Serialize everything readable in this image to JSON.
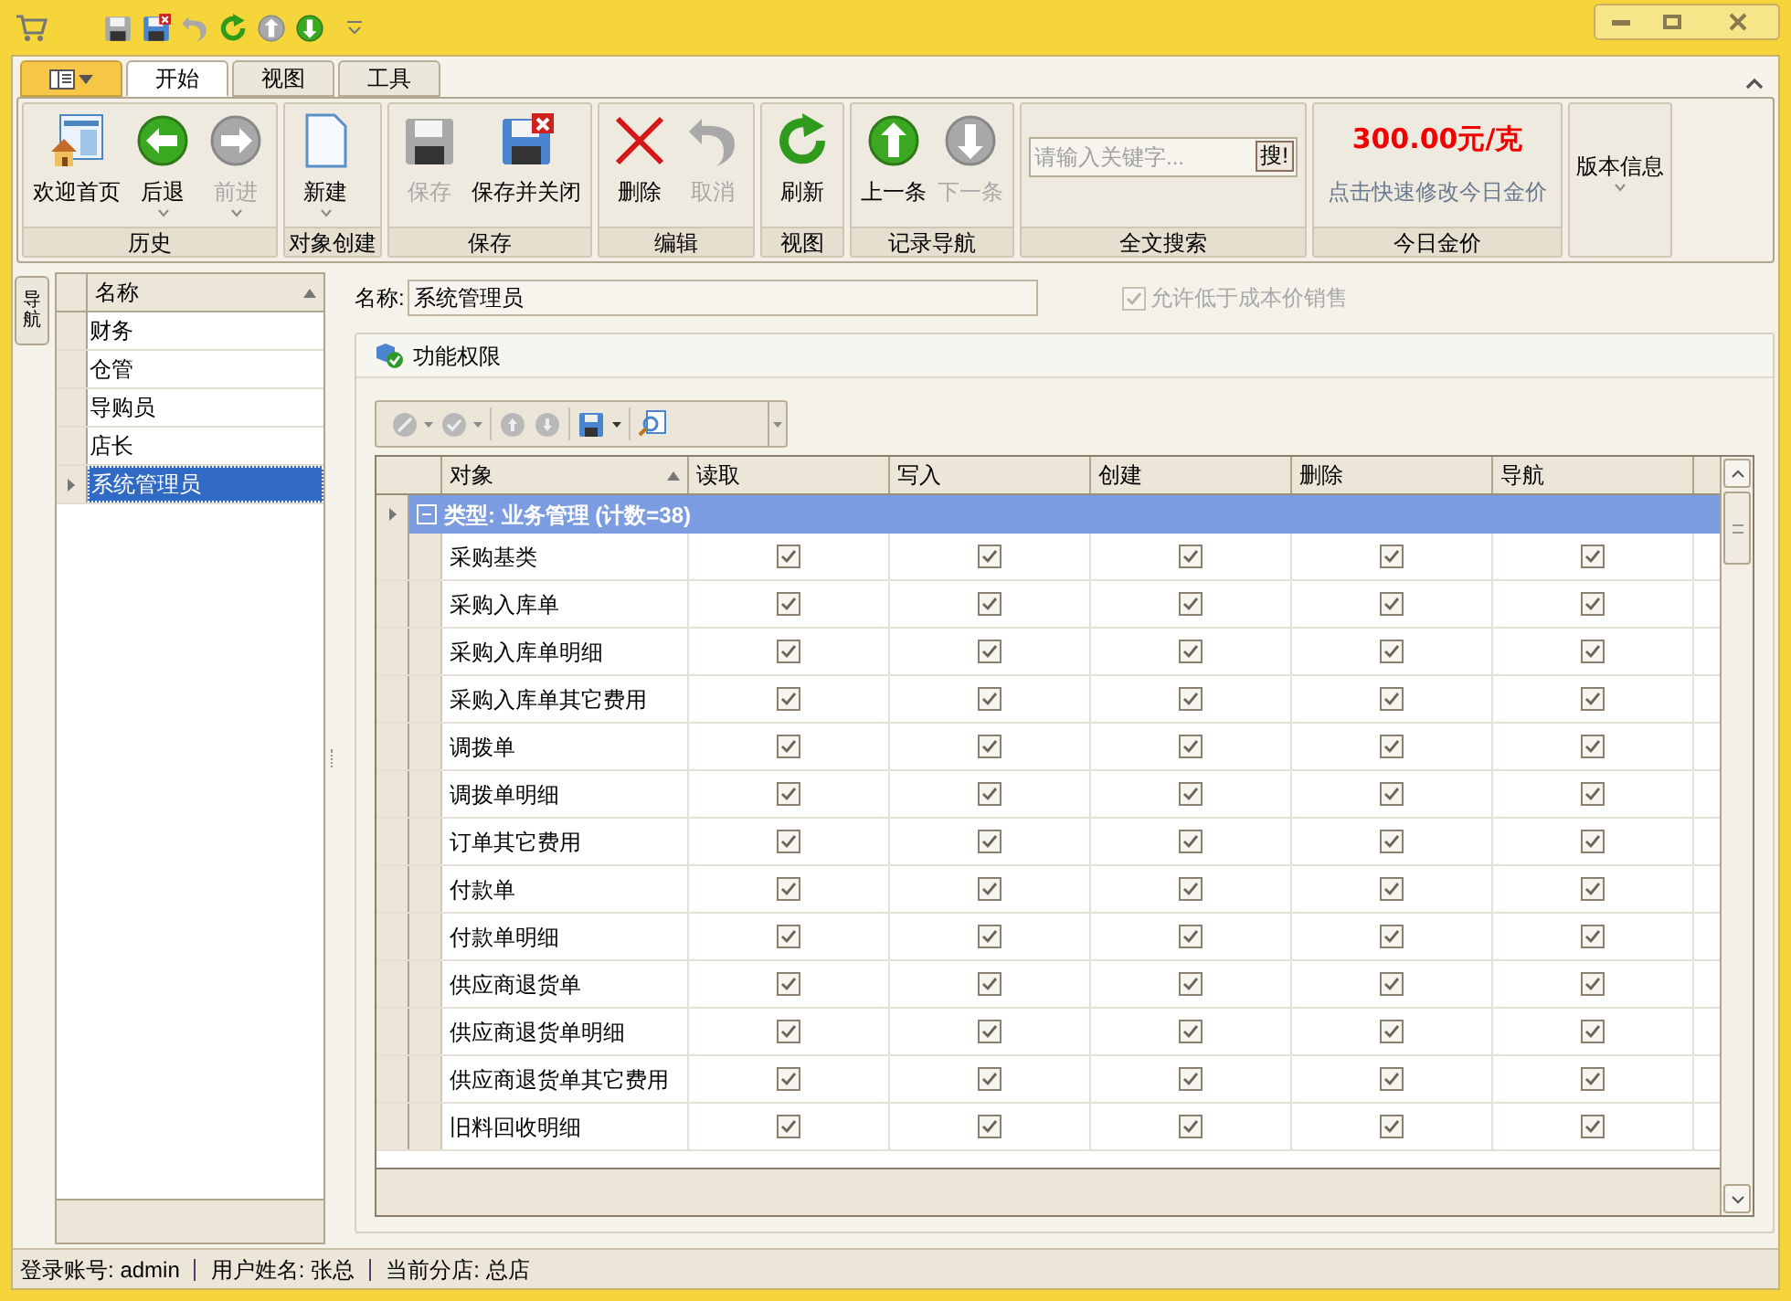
{
  "ribbon_tabs": [
    {
      "label": "开始",
      "selected": true
    },
    {
      "label": "视图",
      "selected": false
    },
    {
      "label": "工具",
      "selected": false
    }
  ],
  "ribbon_groups": [
    {
      "title": "历史",
      "buttons": [
        {
          "label": "欢迎首页",
          "kind": "home",
          "disabled": false,
          "dropdown": false
        },
        {
          "label": "后退",
          "kind": "back",
          "disabled": false,
          "dropdown": true
        },
        {
          "label": "前进",
          "kind": "forward",
          "disabled": true,
          "dropdown": true
        }
      ]
    },
    {
      "title": "对象创建",
      "buttons": [
        {
          "label": "新建",
          "kind": "new",
          "disabled": false,
          "dropdown": true
        }
      ]
    },
    {
      "title": "保存",
      "buttons": [
        {
          "label": "保存",
          "kind": "save",
          "disabled": true,
          "dropdown": false
        },
        {
          "label": "保存并关闭",
          "kind": "saveclose",
          "disabled": false,
          "dropdown": false
        }
      ]
    },
    {
      "title": "编辑",
      "buttons": [
        {
          "label": "删除",
          "kind": "delete",
          "disabled": false,
          "dropdown": false
        },
        {
          "label": "取消",
          "kind": "undo",
          "disabled": true,
          "dropdown": false
        }
      ]
    },
    {
      "title": "视图",
      "buttons": [
        {
          "label": "刷新",
          "kind": "refresh",
          "disabled": false,
          "dropdown": false
        }
      ]
    },
    {
      "title": "记录导航",
      "buttons": [
        {
          "label": "上一条",
          "kind": "up",
          "disabled": false,
          "dropdown": false
        },
        {
          "label": "下一条",
          "kind": "down",
          "disabled": true,
          "dropdown": false
        }
      ]
    }
  ],
  "search": {
    "placeholder": "请输入关键字...",
    "button": "搜!",
    "title": "全文搜索"
  },
  "gold_price": {
    "price": "300.00元/克",
    "link": "点击快速修改今日金价",
    "title": "今日金价"
  },
  "version": {
    "label": "版本信息"
  },
  "side_tab": {
    "label": "导航"
  },
  "roles": {
    "column": "名称",
    "items": [
      {
        "name": "财务",
        "selected": false
      },
      {
        "name": "仓管",
        "selected": false
      },
      {
        "name": "导购员",
        "selected": false
      },
      {
        "name": "店长",
        "selected": false
      },
      {
        "name": "系统管理员",
        "selected": true
      }
    ]
  },
  "name_field": {
    "label": "名称:",
    "value": "系统管理员"
  },
  "allow_below_cost": {
    "label": "允许低于成本价销售",
    "checked": true,
    "disabled": true
  },
  "panel": {
    "title": "功能权限"
  },
  "grid": {
    "columns": [
      "对象",
      "读取",
      "写入",
      "创建",
      "删除",
      "导航"
    ],
    "group": {
      "label": "类型: 业务管理 (计数=38)",
      "expanded": true
    },
    "rows": [
      {
        "name": "采购基类",
        "checks": [
          true,
          true,
          true,
          true,
          true
        ]
      },
      {
        "name": "采购入库单",
        "checks": [
          true,
          true,
          true,
          true,
          true
        ]
      },
      {
        "name": "采购入库单明细",
        "checks": [
          true,
          true,
          true,
          true,
          true
        ]
      },
      {
        "name": "采购入库单其它费用",
        "checks": [
          true,
          true,
          true,
          true,
          true
        ]
      },
      {
        "name": "调拨单",
        "checks": [
          true,
          true,
          true,
          true,
          true
        ]
      },
      {
        "name": "调拨单明细",
        "checks": [
          true,
          true,
          true,
          true,
          true
        ]
      },
      {
        "name": "订单其它费用",
        "checks": [
          true,
          true,
          true,
          true,
          true
        ]
      },
      {
        "name": "付款单",
        "checks": [
          true,
          true,
          true,
          true,
          true
        ]
      },
      {
        "name": "付款单明细",
        "checks": [
          true,
          true,
          true,
          true,
          true
        ]
      },
      {
        "name": "供应商退货单",
        "checks": [
          true,
          true,
          true,
          true,
          true
        ]
      },
      {
        "name": "供应商退货单明细",
        "checks": [
          true,
          true,
          true,
          true,
          true
        ]
      },
      {
        "name": "供应商退货单其它费用",
        "checks": [
          true,
          true,
          true,
          true,
          true
        ]
      },
      {
        "name": "旧料回收明细",
        "checks": [
          true,
          true,
          true,
          true,
          true
        ]
      }
    ]
  },
  "status_bar": [
    {
      "label": "登录账号:",
      "value": "admin"
    },
    {
      "label": "用户姓名:",
      "value": "张总"
    },
    {
      "label": "当前分店:",
      "value": "总店"
    }
  ]
}
